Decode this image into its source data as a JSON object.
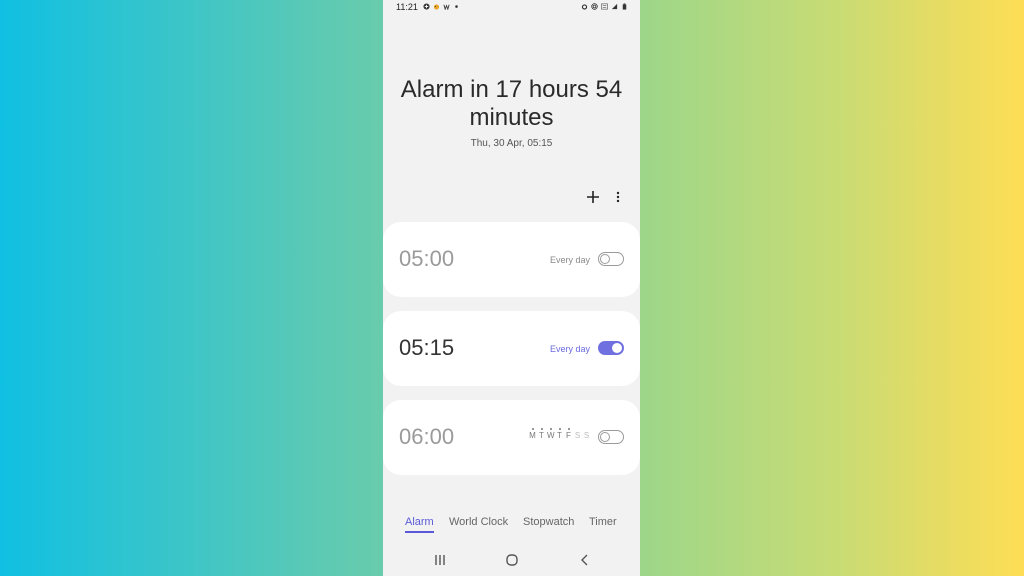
{
  "status_bar": {
    "time": "11:21",
    "left_icons": [
      "gallery-icon",
      "bird-icon",
      "wifi-calling-icon",
      "dot-icon"
    ],
    "right_icons": [
      "alarm-icon",
      "hotspot-icon",
      "lte-icon",
      "signal-icon",
      "battery-icon"
    ]
  },
  "header": {
    "headline": "Alarm in 17 hours 54 minutes",
    "subline": "Thu, 30 Apr, 05:15"
  },
  "toolbar": {
    "add_icon": "plus-icon",
    "more_icon": "more-vertical-icon"
  },
  "alarms": [
    {
      "time": "05:00",
      "repeat": "Every day",
      "enabled": false
    },
    {
      "time": "05:15",
      "repeat": "Every day",
      "enabled": true
    },
    {
      "time": "06:00",
      "days": [
        "M",
        "T",
        "W",
        "T",
        "F",
        "S",
        "S"
      ],
      "active_days": [
        true,
        true,
        true,
        true,
        true,
        false,
        false
      ],
      "enabled": false
    }
  ],
  "tabs": [
    {
      "label": "Alarm",
      "active": true
    },
    {
      "label": "World Clock",
      "active": false
    },
    {
      "label": "Stopwatch",
      "active": false
    },
    {
      "label": "Timer",
      "active": false
    }
  ],
  "nav": [
    "recent-apps-icon",
    "home-icon",
    "back-icon"
  ],
  "colors": {
    "accent": "#5a5ad8",
    "toggle_on": "#7070e0",
    "card": "#ffffff",
    "screen_bg": "#f2f2f2"
  }
}
